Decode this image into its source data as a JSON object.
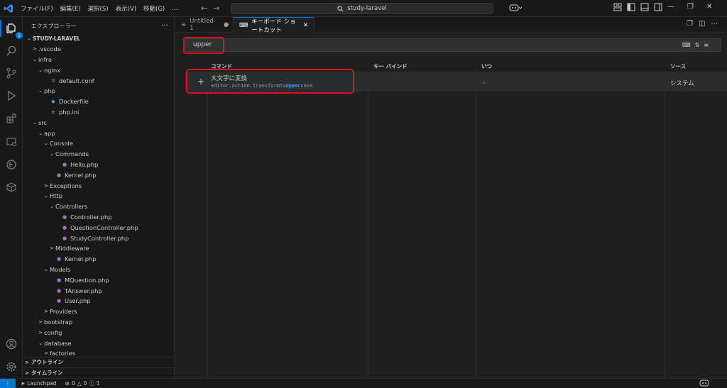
{
  "titlebar": {
    "menu": [
      "ファイル(F)",
      "編集(E)",
      "選択(S)",
      "表示(V)",
      "移動(G)",
      "…"
    ],
    "search": "study-laravel"
  },
  "sidebar": {
    "title": "エクスプローラー",
    "more": "…",
    "tree": [
      {
        "label": "STUDY-LARAVEL",
        "level": 0,
        "chev": "v",
        "icon": "",
        "bold": true
      },
      {
        "label": ".vscode",
        "level": 1,
        "chev": ">",
        "icon": ""
      },
      {
        "label": "infra",
        "level": 1,
        "chev": "v",
        "icon": ""
      },
      {
        "label": "nginx",
        "level": 2,
        "chev": "v",
        "icon": ""
      },
      {
        "label": "default.conf",
        "level": 3,
        "chev": "",
        "icon": "gear"
      },
      {
        "label": "php",
        "level": 2,
        "chev": "v",
        "icon": ""
      },
      {
        "label": "Dockerfile",
        "level": 3,
        "chev": "",
        "icon": "docker"
      },
      {
        "label": "php.ini",
        "level": 3,
        "chev": "",
        "icon": "ini"
      },
      {
        "label": "src",
        "level": 1,
        "chev": "v",
        "icon": ""
      },
      {
        "label": "app",
        "level": 2,
        "chev": "v",
        "icon": ""
      },
      {
        "label": "Console",
        "level": 3,
        "chev": "v",
        "icon": ""
      },
      {
        "label": "Commands",
        "level": 4,
        "chev": "v",
        "icon": ""
      },
      {
        "label": "Hello.php",
        "level": 5,
        "chev": "",
        "icon": "php"
      },
      {
        "label": "Kernel.php",
        "level": 4,
        "chev": "",
        "icon": "php"
      },
      {
        "label": "Exceptions",
        "level": 3,
        "chev": ">",
        "icon": ""
      },
      {
        "label": "Http",
        "level": 3,
        "chev": "v",
        "icon": ""
      },
      {
        "label": "Controllers",
        "level": 4,
        "chev": "v",
        "icon": ""
      },
      {
        "label": "Controller.php",
        "level": 5,
        "chev": "",
        "icon": "php"
      },
      {
        "label": "QuestionController.php",
        "level": 5,
        "chev": "",
        "icon": "php"
      },
      {
        "label": "StudyController.php",
        "level": 5,
        "chev": "",
        "icon": "php"
      },
      {
        "label": "Middleware",
        "level": 4,
        "chev": ">",
        "icon": ""
      },
      {
        "label": "Kernel.php",
        "level": 4,
        "chev": "",
        "icon": "php"
      },
      {
        "label": "Models",
        "level": 3,
        "chev": "v",
        "icon": ""
      },
      {
        "label": "MQuestion.php",
        "level": 4,
        "chev": "",
        "icon": "php"
      },
      {
        "label": "TAnswer.php",
        "level": 4,
        "chev": "",
        "icon": "php"
      },
      {
        "label": "User.php",
        "level": 4,
        "chev": "",
        "icon": "php"
      },
      {
        "label": "Providers",
        "level": 3,
        "chev": ">",
        "icon": ""
      },
      {
        "label": "bootstrap",
        "level": 2,
        "chev": ">",
        "icon": ""
      },
      {
        "label": "config",
        "level": 2,
        "chev": ">",
        "icon": ""
      },
      {
        "label": "database",
        "level": 2,
        "chev": "v",
        "icon": ""
      },
      {
        "label": "factories",
        "level": 3,
        "chev": ">",
        "icon": ""
      }
    ],
    "outline": "アウトライン",
    "timeline": "タイムライン"
  },
  "tabs": [
    {
      "label": "Untitled-1",
      "modified": true
    },
    {
      "label": "キーボード ショートカット",
      "active": true
    }
  ],
  "keybindings": {
    "search_value": "upper",
    "columns": [
      "コマンド",
      "キー バインド",
      "いつ",
      "ソース"
    ],
    "row": {
      "command_title": "大文字に変換",
      "command_id_prefix": "editor.action.transformTo",
      "command_id_match": "Upper",
      "command_id_suffix": "case",
      "when": "-",
      "source": "システム"
    }
  },
  "activity": {
    "badge": "1"
  },
  "status": {
    "launchpad": "Launchpad",
    "errors": "0",
    "warnings": "0",
    "info": "1"
  }
}
